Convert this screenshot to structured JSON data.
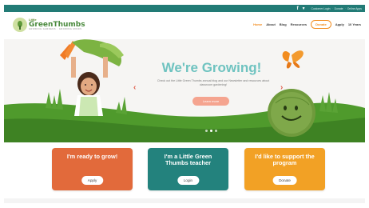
{
  "colors": {
    "topbar": "#227b76",
    "accent": "#f28c1e",
    "hero_title": "#6fc3c0",
    "card_grow": "#e26a3b",
    "card_teacher": "#23827d",
    "card_support": "#f2a125"
  },
  "topbar": {
    "social": [
      {
        "icon": "facebook-icon",
        "glyph": "f"
      },
      {
        "icon": "twitter-icon",
        "glyph": "🐦"
      }
    ],
    "links": [
      "Customer Login",
      "Donate",
      "Online Apps"
    ]
  },
  "logo": {
    "line1": "Little",
    "line2": "GreenThumbs",
    "line3": "GROWING GARDENS · GROWING MINDS"
  },
  "nav": {
    "items": [
      "Home",
      "About",
      "Blog",
      "Resources"
    ],
    "donate": "Donate",
    "extra": [
      "Apply",
      "10 Years"
    ]
  },
  "hero": {
    "title": "We're Growing!",
    "subtitle": "Check out the Little Green Thumbs annual blog and our Newsletter and resources about classroom gardening!",
    "cta": "Learn more",
    "prev": "‹",
    "next": "›"
  },
  "cards": [
    {
      "title": "I'm ready to grow!",
      "button": "Apply"
    },
    {
      "title": "I'm a Little Green Thumbs teacher",
      "button": "Login"
    },
    {
      "title": "I'd like to support the program",
      "button": "Donate"
    }
  ]
}
